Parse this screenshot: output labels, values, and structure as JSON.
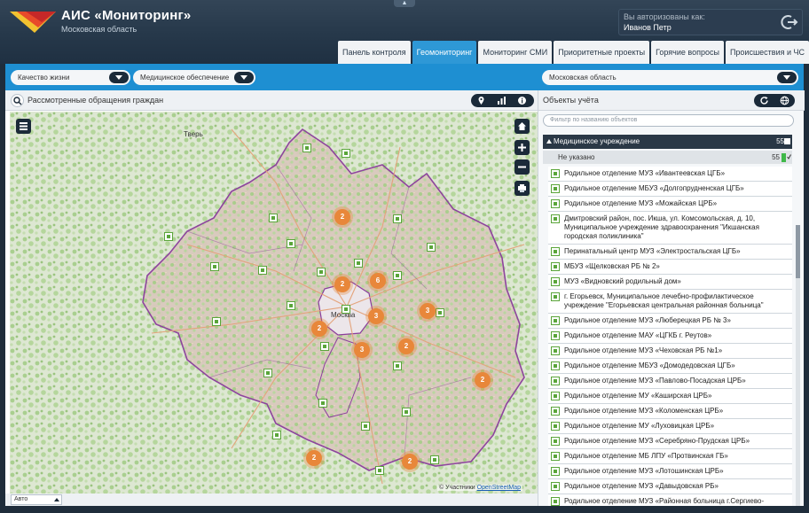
{
  "app": {
    "title": "АИС «Мониторинг»",
    "subtitle": "Московская область"
  },
  "auth": {
    "label": "Вы авторизованы как:",
    "user": "Иванов Петр"
  },
  "tabs": [
    {
      "label": "Панель контроля",
      "active": false
    },
    {
      "label": "Геомониторинг",
      "active": true
    },
    {
      "label": "Мониторинг СМИ",
      "active": false
    },
    {
      "label": "Приоритетные проекты",
      "active": false
    },
    {
      "label": "Горячие вопросы",
      "active": false
    },
    {
      "label": "Происшествия и ЧС",
      "active": false
    }
  ],
  "filters": {
    "quality": "Качество жизни",
    "medicine": "Медицинское обеспечение",
    "region": "Московская область"
  },
  "map_panel": {
    "title": "Рассмотренные обращения граждан",
    "attribution_prefix": "© Участники",
    "attribution_link": "OpenStreetMap",
    "zoom_value": "Авто"
  },
  "map_labels": {
    "tver": "Тверь",
    "moscow": "Москва"
  },
  "clusters": [
    "2",
    "2",
    "6",
    "3",
    "3",
    "2",
    "3",
    "2",
    "2",
    "2",
    "2"
  ],
  "objects_panel": {
    "title": "Объекты учёта",
    "filter_placeholder": "Фильтр по названию объектов",
    "category": "Медицинское учреждение",
    "category_count": "55",
    "subcategory": "Не указано",
    "subcategory_count": "55",
    "items": [
      "Родильное отделение МУЗ «Ивантеевская ЦГБ»",
      "Родильное отделение МБУЗ «Долгопрудненская ЦГБ»",
      "Родильное отделение МУЗ «Можайская ЦРБ»",
      "Дмитровский район, пос. Икша, ул. Комсомольская, д. 10, Муниципальное учреждение здравоохранения \"Икшанская городская поликлиника\"",
      "Перинатальный центр МУЗ «Электростальская ЦГБ»",
      "МБУЗ «Щелковская РБ № 2»",
      "МУЗ «Видновский родильный дом»",
      "г. Егорьевск, Муниципальное лечебно-профилактическое учреждение \"Егорьевская центральная районная больница\"",
      "Родильное отделение МУЗ «Люберецкая РБ № 3»",
      "Родильное отделение МАУ «ЦГКБ г. Реутов»",
      "Родильное отделение МУЗ «Чеховская РБ №1»",
      "Родильное отделение МБУЗ «Домодедовская ЦГБ»",
      "Родильное отделение МУЗ «Павлово-Посадская ЦРБ»",
      "Родильное отделение МУ «Каширская ЦРБ»",
      "Родильное отделение МУЗ «Коломенская ЦРБ»",
      "Родильное отделение МУ «Луховицкая ЦРБ»",
      "Родильное отделение МУЗ «Серебряно-Прудская ЦРБ»",
      "Родильное отделение МБ ЛПУ «Протвинская ГБ»",
      "Родильное отделение МУЗ «Лотошинская ЦРБ»",
      "Родильное отделение МУЗ «Давыдовская РБ»",
      "Родильное отделение МУЗ «Районная больница г.Сергиево-Посада»"
    ]
  },
  "colors": {
    "header_bg": "#26384a",
    "accent_blue": "#1e8fd2",
    "active_tab": "#2e98d6",
    "cluster_orange": "#e8873a",
    "marker_green": "#5aa53a",
    "region_border": "#8a3d9c"
  },
  "icons": {
    "logo": "logo-icon",
    "logout": "logout-icon",
    "search": "search-icon",
    "map_view": "pin-icon",
    "chart_view": "bar-chart-icon",
    "info_view": "info-icon",
    "home": "home-icon",
    "zoom_in": "plus-icon",
    "zoom_out": "minus-icon",
    "print": "printer-icon",
    "layers": "layers-icon",
    "refresh": "refresh-icon",
    "globe": "globe-icon"
  }
}
